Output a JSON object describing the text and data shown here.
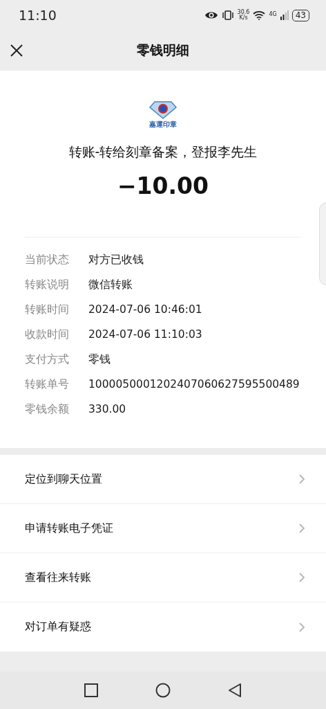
{
  "status_bar": {
    "time": "11:10",
    "speed_value": "30.6",
    "speed_unit": "K/s",
    "network": "4G",
    "battery": "43"
  },
  "header": {
    "title": "零钱明细"
  },
  "merchant": {
    "logo_text": "嘉運印章",
    "description": "转账-转给刻章备案，登报李先生",
    "amount": "−10.00"
  },
  "details": [
    {
      "label": "当前状态",
      "value": "对方已收钱"
    },
    {
      "label": "转账说明",
      "value": "微信转账"
    },
    {
      "label": "转账时间",
      "value": "2024-07-06 10:46:01"
    },
    {
      "label": "收款时间",
      "value": "2024-07-06 11:10:03"
    },
    {
      "label": "支付方式",
      "value": "零钱"
    },
    {
      "label": "转账单号",
      "value": "1000050001202407060627595500489"
    },
    {
      "label": "零钱余额",
      "value": "330.00"
    }
  ],
  "actions": [
    "定位到聊天位置",
    "申请转账电子凭证",
    "查看往来转账",
    "对订单有疑惑"
  ]
}
